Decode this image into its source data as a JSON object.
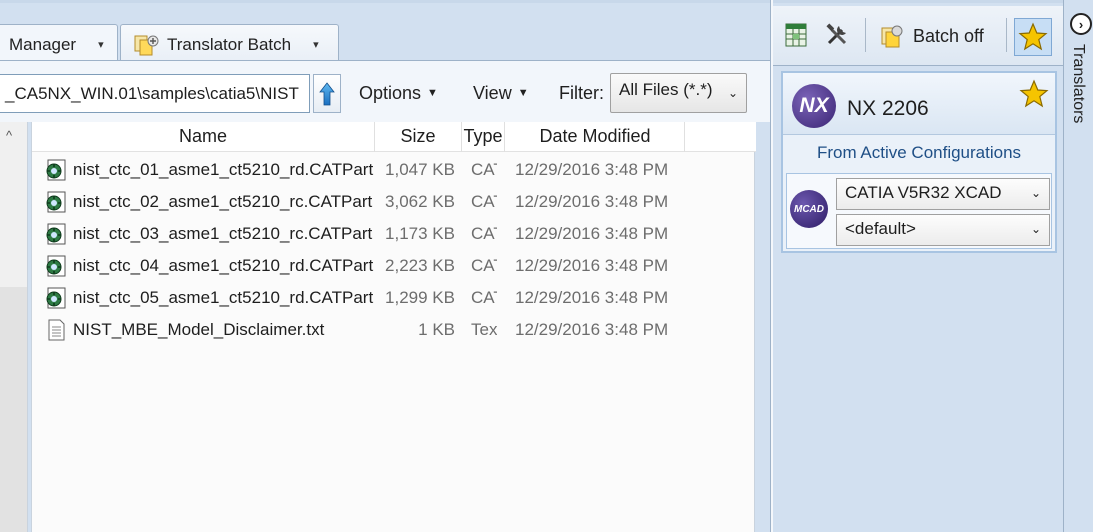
{
  "tabs": [
    {
      "label": "Manager"
    },
    {
      "label": "Translator Batch"
    }
  ],
  "nav": {
    "path": "_CA5NX_WIN.01\\samples\\catia5\\NIST",
    "options_label": "Options",
    "view_label": "View",
    "filter_label": "Filter:",
    "filter_value": "All Files (*.*)"
  },
  "file_list": {
    "columns": [
      "Name",
      "Size",
      "Type",
      "Date Modified"
    ],
    "rows": [
      {
        "name": "nist_ctc_01_asme1_ct5210_rd.CATPart",
        "size": "1,047 KB",
        "type": "CAT",
        "date": "12/29/2016 3:48 PM",
        "icon": "catpart-icon"
      },
      {
        "name": "nist_ctc_02_asme1_ct5210_rc.CATPart",
        "size": "3,062 KB",
        "type": "CAT",
        "date": "12/29/2016 3:48 PM",
        "icon": "catpart-icon"
      },
      {
        "name": "nist_ctc_03_asme1_ct5210_rc.CATPart",
        "size": "1,173 KB",
        "type": "CAT",
        "date": "12/29/2016 3:48 PM",
        "icon": "catpart-icon"
      },
      {
        "name": "nist_ctc_04_asme1_ct5210_rd.CATPart",
        "size": "2,223 KB",
        "type": "CAT",
        "date": "12/29/2016 3:48 PM",
        "icon": "catpart-icon"
      },
      {
        "name": "nist_ctc_05_asme1_ct5210_rd.CATPart",
        "size": "1,299 KB",
        "type": "CAT",
        "date": "12/29/2016 3:48 PM",
        "icon": "catpart-icon"
      },
      {
        "name": "NIST_MBE_Model_Disclaimer.txt",
        "size": "1 KB",
        "type": "Tex",
        "date": "12/29/2016 3:48 PM",
        "icon": "text-file-icon"
      }
    ]
  },
  "right_toolbar": {
    "batch_off_label": "Batch off"
  },
  "config": {
    "nx_logo": "NX",
    "nx_title": "NX 2206",
    "from_label": "From Active Configurations",
    "mcad_logo": "MCAD",
    "cad_value": "CATIA V5R32 XCAD",
    "default_value": "<default>"
  },
  "sidebar": {
    "label": "Translators"
  },
  "colors": {
    "panel_bg": "#d2e0f0",
    "accent_blue": "#1f4f86",
    "star": "#f5c400"
  }
}
